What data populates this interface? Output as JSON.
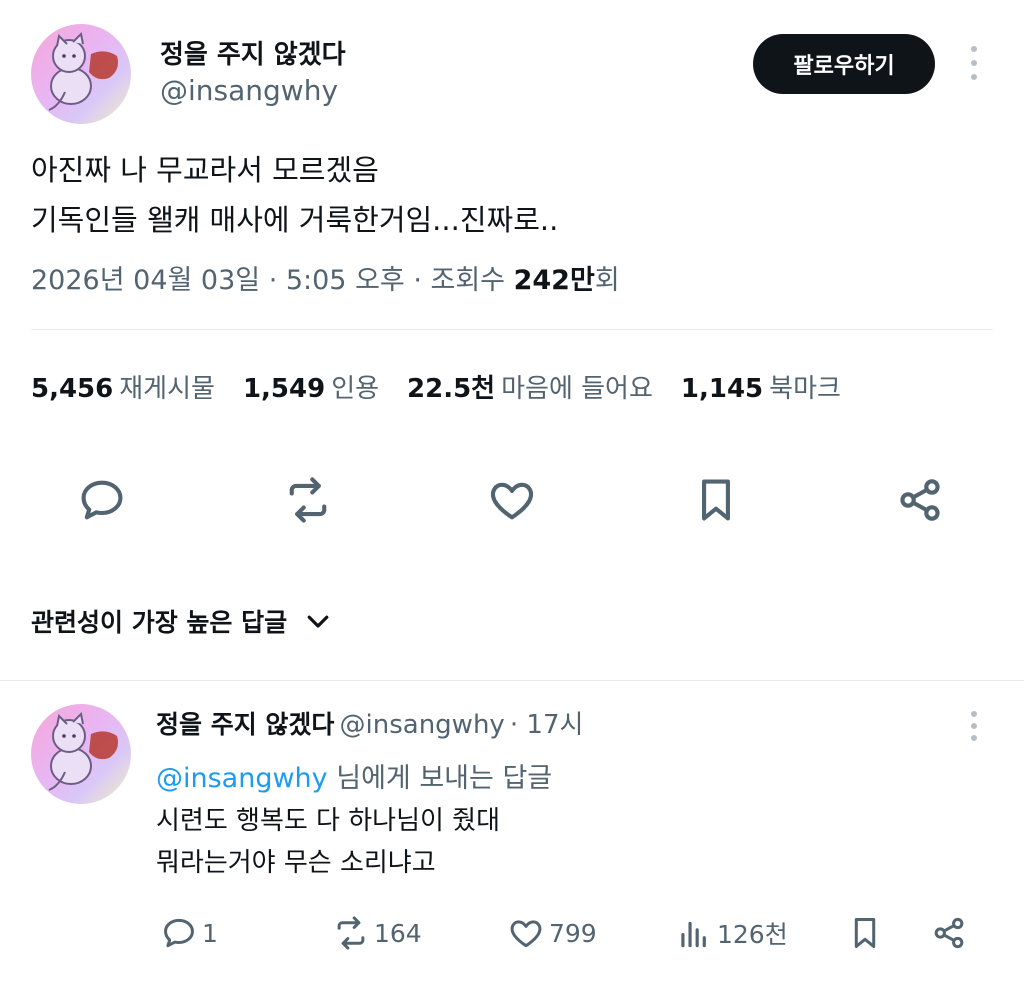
{
  "tweet": {
    "author_name": "정을 주지 않겠다",
    "author_handle": "@insangwhy",
    "follow_label": "팔로우하기",
    "text_lines": [
      "아진짜 나 무교라서 모르겠음",
      "기독인들 왤캐 매사에 거룩한거임...진짜로.."
    ],
    "timestamp": "2026년 04월 03일 · 5:05 오후 · 조회수 ",
    "views": "242만",
    "views_suffix": "회"
  },
  "stats": {
    "reposts_count": "5,456",
    "reposts_label": "재게시물",
    "quotes_count": "1,549",
    "quotes_label": "인용",
    "likes_count": "22.5천",
    "likes_label": "마음에 들어요",
    "bookmarks_count": "1,145",
    "bookmarks_label": "북마크"
  },
  "actions": [
    "reply-icon",
    "repost-icon",
    "like-icon",
    "bookmark-icon",
    "share-icon"
  ],
  "replies_sort": {
    "label": "관련성이 가장 높은 답글"
  },
  "reply": {
    "author_name": "정을 주지 않겠다",
    "author_handle": "@insangwhy",
    "time": "· 17시",
    "reply_to_mention": "@insangwhy",
    "reply_to_suffix": " 님에게 보내는 답글",
    "text_lines": [
      "시련도 행복도 다 하나님이 줬대",
      "뭐라는거야 무슨 소리냐고"
    ],
    "reply_count": "1",
    "repost_count": "164",
    "like_count": "799",
    "view_count": "126천"
  },
  "colors": {
    "text": "#0f1419",
    "muted": "#536471",
    "accent": "#1d9bf0",
    "divider": "#e6eaed"
  }
}
